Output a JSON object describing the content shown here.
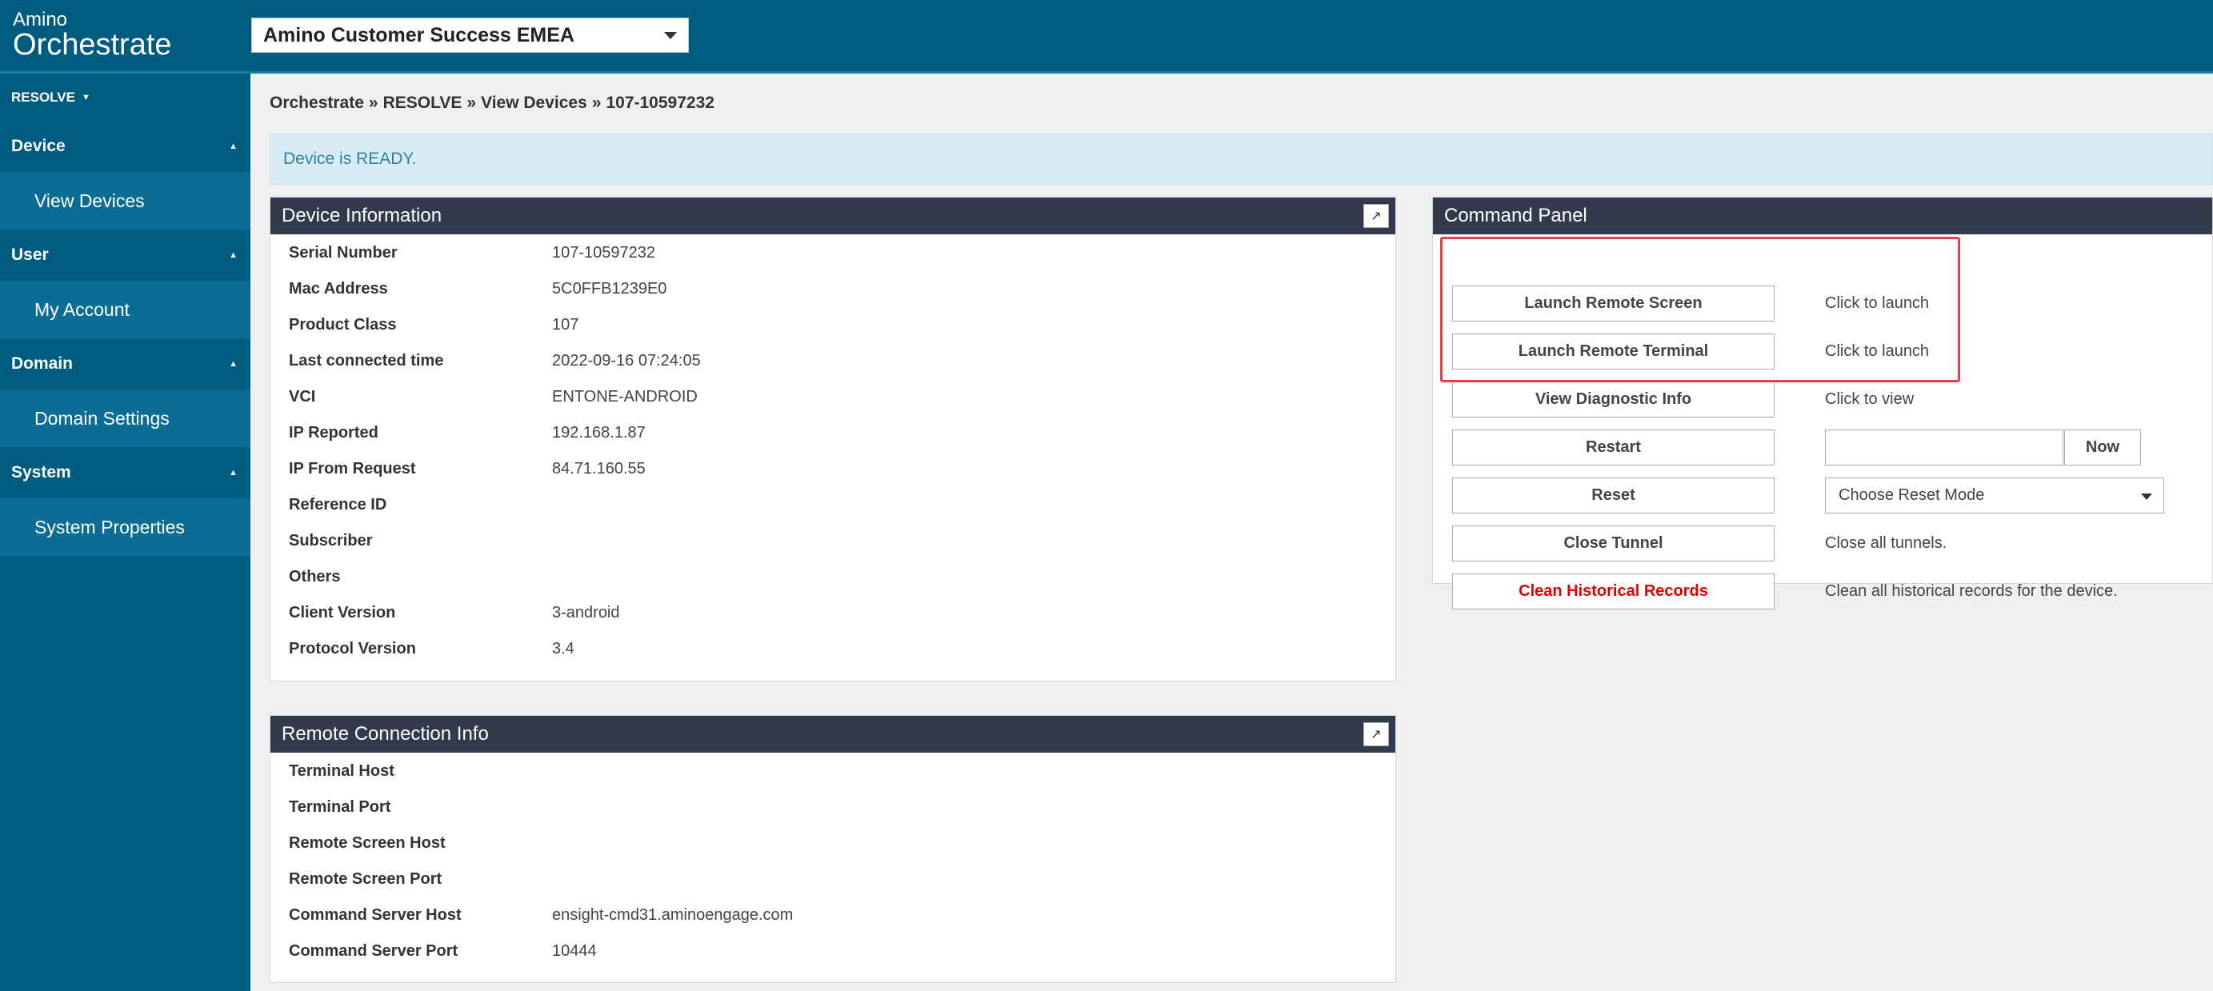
{
  "app": {
    "logo_small": "Amino",
    "logo_big": "Orchestrate",
    "domain_selected": "Amino Customer Success EMEA"
  },
  "sidebar": {
    "resolve_label": "RESOLVE",
    "sections": [
      {
        "label": "Device",
        "item": "View Devices"
      },
      {
        "label": "User",
        "item": "My Account"
      },
      {
        "label": "Domain",
        "item": "Domain Settings"
      },
      {
        "label": "System",
        "item": "System Properties"
      }
    ]
  },
  "breadcrumb": [
    "Orchestrate",
    "RESOLVE",
    "View Devices",
    "107-10597232"
  ],
  "breadcrumb_sep": "»",
  "alert": "Device is READY.",
  "device_info": {
    "title": "Device Information",
    "rows": [
      {
        "label": "Serial Number",
        "value": "107-10597232"
      },
      {
        "label": "Mac Address",
        "value": "5C0FFB1239E0"
      },
      {
        "label": "Product Class",
        "value": "107"
      },
      {
        "label": "Last connected time",
        "value": "2022-09-16 07:24:05"
      },
      {
        "label": "VCI",
        "value": "ENTONE-ANDROID"
      },
      {
        "label": "IP Reported",
        "value": "192.168.1.87"
      },
      {
        "label": "IP From Request",
        "value": "84.71.160.55"
      },
      {
        "label": "Reference ID",
        "value": ""
      },
      {
        "label": "Subscriber",
        "value": ""
      },
      {
        "label": "Others",
        "value": ""
      },
      {
        "label": "Client Version",
        "value": "3-android"
      },
      {
        "label": "Protocol Version",
        "value": "3.4"
      }
    ]
  },
  "remote_info": {
    "title": "Remote Connection Info",
    "rows": [
      {
        "label": "Terminal Host",
        "value": ""
      },
      {
        "label": "Terminal Port",
        "value": ""
      },
      {
        "label": "Remote Screen Host",
        "value": ""
      },
      {
        "label": "Remote Screen Port",
        "value": ""
      },
      {
        "label": "Command Server Host",
        "value": "ensight-cmd31.aminoengage.com"
      },
      {
        "label": "Command Server Port",
        "value": "10444"
      }
    ]
  },
  "command_panel": {
    "title": "Command Panel",
    "launch_screen": {
      "label": "Launch Remote Screen",
      "desc": "Click to launch"
    },
    "launch_terminal": {
      "label": "Launch Remote Terminal",
      "desc": "Click to launch"
    },
    "diagnostic": {
      "label": "View Diagnostic Info",
      "desc": "Click to view"
    },
    "restart": {
      "label": "Restart",
      "now_label": "Now",
      "input_value": ""
    },
    "reset": {
      "label": "Reset",
      "mode_selected": "Choose Reset Mode"
    },
    "close_tunnel": {
      "label": "Close Tunnel",
      "desc": "Close all tunnels."
    },
    "clean": {
      "label": "Clean Historical Records",
      "desc": "Clean all historical records for the device."
    }
  },
  "icons": {
    "expand": "expand-icon",
    "dropdown": "chevron-down-icon",
    "collapse": "caret-up-icon"
  },
  "colors": {
    "brand": "#005c7f",
    "panel_header": "#313b4b",
    "alert_bg": "#d8ecf4",
    "danger": "#e00000",
    "highlight": "#e0424a"
  }
}
